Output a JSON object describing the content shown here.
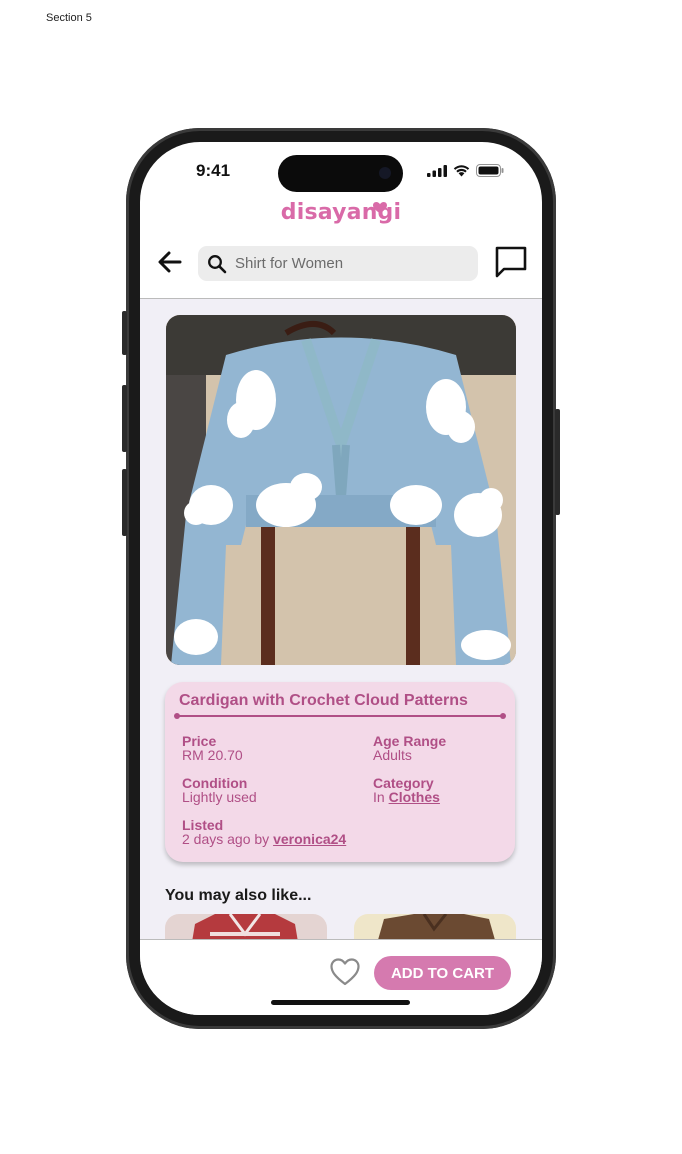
{
  "frame": {
    "section_label": "Section 5"
  },
  "status_bar": {
    "time": "9:41"
  },
  "brand": {
    "logo_text": "disayangi",
    "color": "#d96aa8"
  },
  "search": {
    "placeholder": "Shirt for Women"
  },
  "icons": {
    "back": "arrow-left-icon",
    "search": "search-icon",
    "chat": "chat-bubble-icon",
    "favorite": "heart-outline-icon"
  },
  "product": {
    "title": "Cardigan with Crochet Cloud Patterns",
    "price_label": "Price",
    "price_value": "RM 20.70",
    "age_label": "Age Range",
    "age_value": "Adults",
    "condition_label": "Condition",
    "condition_value": "Lightly used",
    "category_label": "Category",
    "category_prefix": "In",
    "category_link": "Clothes",
    "listed_label": "Listed",
    "listed_prefix": "2 days ago by",
    "listed_user": "veronica24"
  },
  "recommendations": {
    "heading": "You may also like..."
  },
  "actions": {
    "add_to_cart": "ADD TO CART"
  },
  "colors": {
    "accent": "#d57aaf",
    "card_bg": "#f3d9e8",
    "card_text": "#b04f86",
    "content_bg": "#f1eff6"
  }
}
